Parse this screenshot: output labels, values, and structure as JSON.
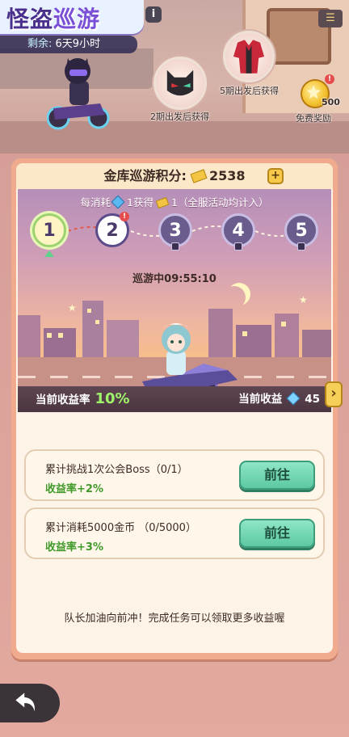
{
  "event": {
    "title_part1": "怪盗",
    "title_part2": "巡游",
    "remaining_label": "剩余:",
    "remaining_value": "6天9小时"
  },
  "rewards": [
    {
      "caption": "2期出发后获得",
      "icon": "black-cat-helmet-icon"
    },
    {
      "caption": "5期出发后获得",
      "icon": "red-jacket-icon"
    },
    {
      "caption": "免费奖励",
      "amount": "500",
      "icon": "gold-coin-icon"
    }
  ],
  "panel": {
    "score_label": "金库巡游积分:",
    "score_value": "2538",
    "consume_text_1": "每消耗",
    "consume_text_2": "1获得",
    "consume_text_3": "1（全服活动均计入）",
    "stages": [
      "1",
      "2",
      "3",
      "4",
      "5"
    ],
    "cruise_status": "巡游中09:55:10",
    "earn_rate_label": "当前收益率",
    "earn_rate_value": "10%",
    "earn_label": "当前收益",
    "earn_value": "45"
  },
  "tasks": [
    {
      "name": "累计挑战1次公会Boss（0/1）",
      "bonus": "收益率+2%",
      "button": "前往"
    },
    {
      "name": "累计消耗5000金币 （0/5000）",
      "bonus": "收益率+3%",
      "button": "前往"
    }
  ],
  "tip": "队长加油向前冲！完成任务可以领取更多收益喔",
  "colors": {
    "accent_green": "#5cc9a2",
    "rate_green": "#9ff56a",
    "panel_orange": "#f0ab8f"
  }
}
